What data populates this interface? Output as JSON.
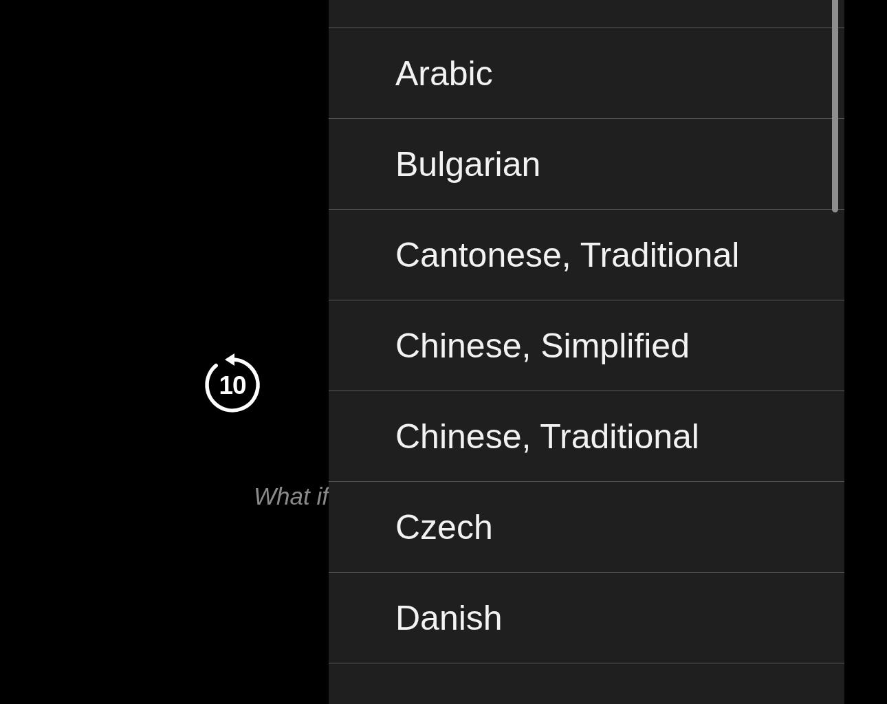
{
  "player": {
    "skip_back": {
      "label": "10"
    },
    "caption": "What if"
  },
  "language_menu": {
    "items": [
      {
        "label": "Arabic",
        "selected": false
      },
      {
        "label": "Bulgarian",
        "selected": false
      },
      {
        "label": "Cantonese, Traditional",
        "selected": false
      },
      {
        "label": "Chinese, Simplified",
        "selected": false
      },
      {
        "label": "Chinese, Traditional",
        "selected": false
      },
      {
        "label": "Czech",
        "selected": false
      },
      {
        "label": "Danish",
        "selected": false
      }
    ]
  }
}
